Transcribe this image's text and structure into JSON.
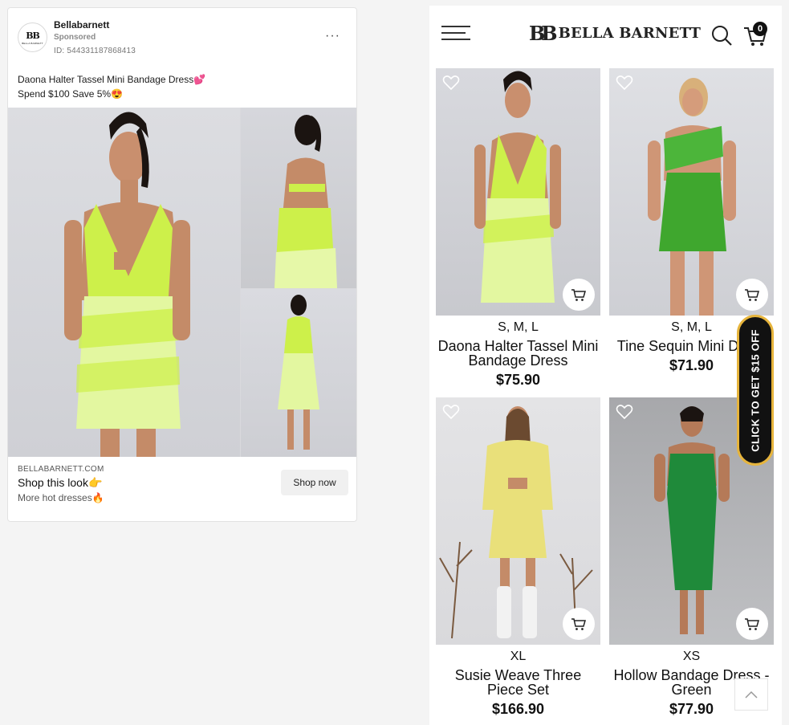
{
  "ad": {
    "page_name": "Bellabarnett",
    "sponsored": "Sponsored",
    "id_text": "ID: 544331187868413",
    "menu": "···",
    "text_line1": "Daona Halter Tassel Mini Bandage Dress💕",
    "text_line2": "Spend $100 Save 5%😍",
    "domain": "BELLABARNETT.COM",
    "title": "Shop this look👉",
    "subtitle": "More hot dresses🔥",
    "cta": "Shop now",
    "avatar_mark": "BB",
    "avatar_tiny": "BELLA BARNETT"
  },
  "shop": {
    "brand_mark": "BB",
    "brand": "BELLA BARNETT",
    "cart_count": "0",
    "products": [
      {
        "sizes": "S, M, L",
        "name": "Daona Halter Tassel Mini Bandage Dress",
        "price": "$75.90",
        "dress_color": "#c9f24a"
      },
      {
        "sizes": "S, M, L",
        "name": "Tine Sequin Mini Dress",
        "price": "$71.90",
        "dress_color": "#3fa72e"
      },
      {
        "sizes": "XL",
        "name": "Susie Weave Three Piece Set",
        "price": "$166.90",
        "dress_color": "#e9e07a"
      },
      {
        "sizes": "XS",
        "name": "Hollow Bandage Dress - Green",
        "price": "$77.90",
        "dress_color": "#1f8a3a"
      }
    ],
    "promo": "CLICK TO GET $15 OFF"
  },
  "colors": {
    "promo_bg": "#111111",
    "promo_border": "#e6b43c"
  }
}
